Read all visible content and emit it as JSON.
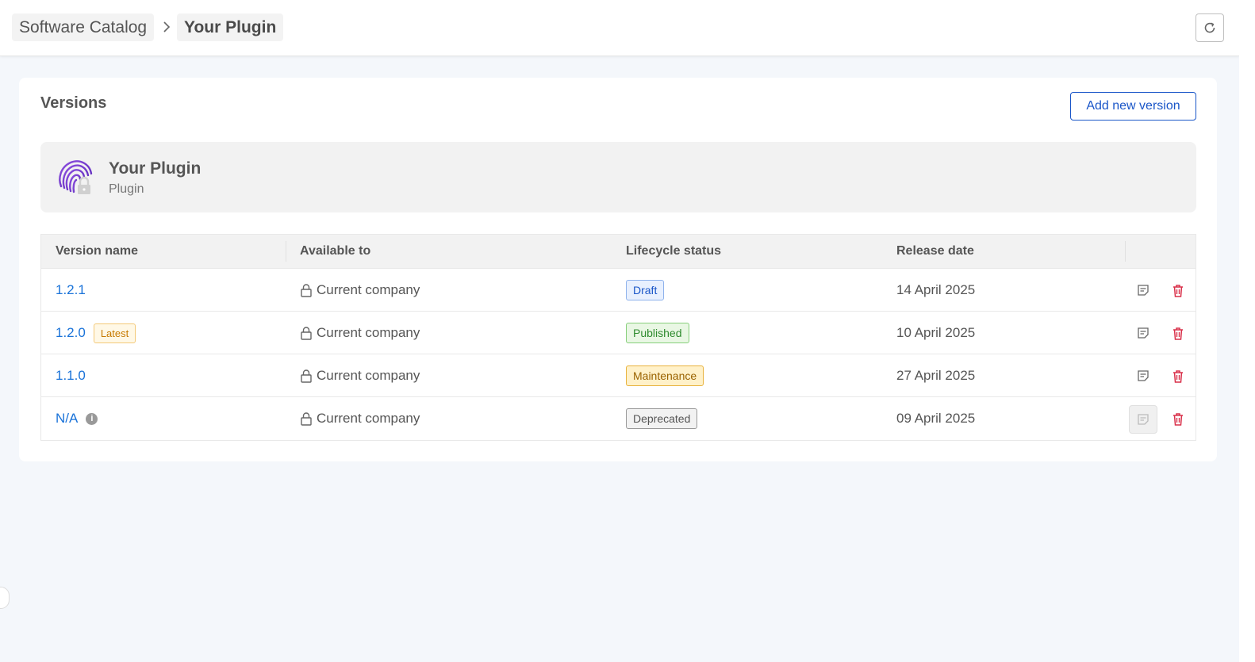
{
  "breadcrumb": {
    "items": [
      "Software Catalog",
      "Your Plugin"
    ],
    "separator_icon": "chevron-right-icon"
  },
  "header": {
    "refresh_icon": "refresh-icon"
  },
  "versions": {
    "title": "Versions",
    "add_button_label": "Add new version"
  },
  "plugin": {
    "name": "Your Plugin",
    "type": "Plugin",
    "icon": "fingerprint-lock-icon"
  },
  "table": {
    "columns": [
      "Version name",
      "Available to",
      "Lifecycle status",
      "Release date"
    ],
    "rows": [
      {
        "version": "1.2.1",
        "badge": "",
        "available": "Current company",
        "status": "Draft",
        "date": "14 April 2025"
      },
      {
        "version": "1.2.0",
        "badge": "Latest",
        "available": "Current company",
        "status": "Published",
        "date": "10 April 2025"
      },
      {
        "version": "1.1.0",
        "badge": "",
        "available": "Current company",
        "status": "Maintenance",
        "date": "27 April 2025"
      },
      {
        "version": "N/A",
        "badge": "",
        "available": "Current company",
        "status": "Deprecated",
        "date": "09 April 2025"
      }
    ]
  },
  "colors": {
    "link": "#1a73d9",
    "primary": "#1a56c8",
    "delete": "#d9304a"
  }
}
